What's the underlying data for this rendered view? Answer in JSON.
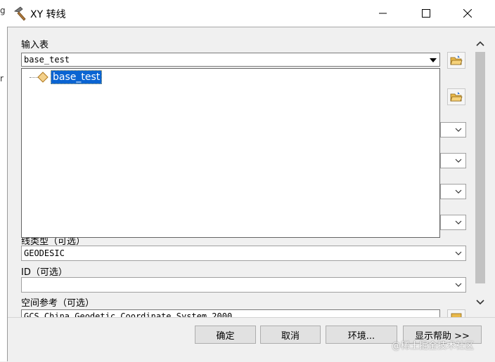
{
  "window": {
    "title": "XY 转线",
    "icon": "hammer-icon"
  },
  "fields": {
    "input_table": {
      "label": "输入表",
      "value": "base_test"
    },
    "line_type": {
      "label": "线类型（可选）",
      "value": "GEODESIC"
    },
    "id": {
      "label": "ID（可选）",
      "value": ""
    },
    "spatial_reference": {
      "label": "空间参考（可选）",
      "value": "GCS_China_Geodetic_Coordinate_System_2000"
    }
  },
  "dropdown": {
    "items": [
      {
        "label": "base_test",
        "selected": true,
        "icon": "table-diamond-icon"
      }
    ]
  },
  "buttons": {
    "ok": "确定",
    "cancel": "取消",
    "environments": "环境...",
    "show_help": "显示帮助 >>"
  },
  "background": {
    "left_glyph_top": "g",
    "left_glyph_mid": "r"
  },
  "watermark": "@稀土掘金技术社区",
  "colors": {
    "selection": "#0a64d2",
    "required_dot": "#10c010",
    "titlebar": "#ffffff"
  }
}
